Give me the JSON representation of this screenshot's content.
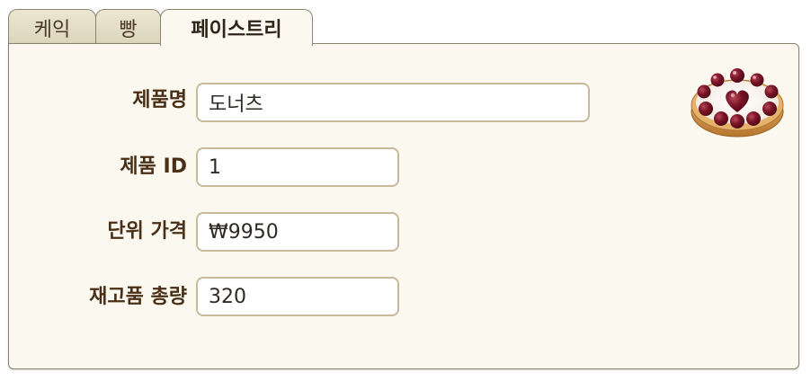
{
  "tabs": [
    {
      "label": "케익",
      "active": false
    },
    {
      "label": "빵",
      "active": false
    },
    {
      "label": "페이스트리",
      "active": true
    }
  ],
  "form": {
    "product_name": {
      "label": "제품명",
      "value": "도너츠"
    },
    "product_id": {
      "label": "제품 ID",
      "value": "1"
    },
    "unit_price": {
      "label": "단위 가격",
      "value": "₩9950"
    },
    "stock_total": {
      "label": "재고품 총량",
      "value": "320"
    }
  },
  "colors": {
    "panel_bg": "#fbf8ef",
    "border": "#8a8472",
    "label_text": "#4a2f16",
    "field_border": "#c8b99b"
  },
  "icons": {
    "product_image": "cherry-tart-icon"
  }
}
